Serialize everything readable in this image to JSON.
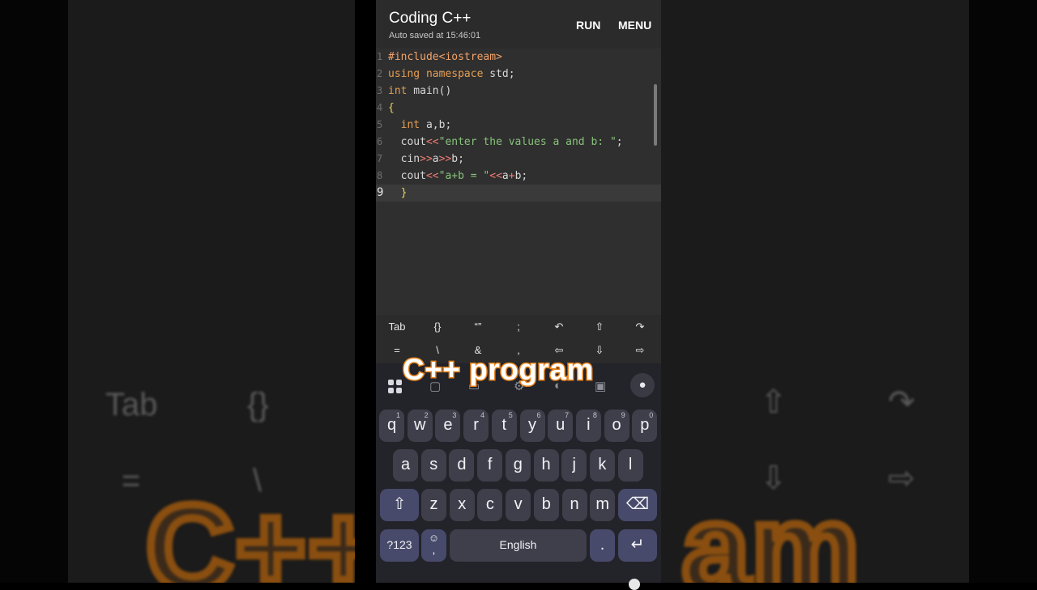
{
  "app": {
    "title": "Coding C++",
    "autosave": "Auto saved at 15:46:01",
    "run_label": "RUN",
    "menu_label": "MENU"
  },
  "editor": {
    "active_line": 9,
    "lines": [
      {
        "n": "1",
        "parts": [
          [
            "pre",
            "#include<iostream>"
          ]
        ]
      },
      {
        "n": "2",
        "parts": [
          [
            "kw",
            "using"
          ],
          [
            "plain",
            " "
          ],
          [
            "kw",
            "namespace"
          ],
          [
            "plain",
            " std;"
          ]
        ]
      },
      {
        "n": "3",
        "parts": [
          [
            "kw",
            "int"
          ],
          [
            "plain",
            " main()"
          ]
        ]
      },
      {
        "n": "4",
        "parts": [
          [
            "brace",
            "{"
          ]
        ]
      },
      {
        "n": "5",
        "parts": [
          [
            "plain",
            "  "
          ],
          [
            "kw",
            "int"
          ],
          [
            "plain",
            " a,b;"
          ]
        ]
      },
      {
        "n": "6",
        "parts": [
          [
            "plain",
            "  cout"
          ],
          [
            "op",
            "<<"
          ],
          [
            "str",
            "\"enter the values a and b: \""
          ],
          [
            "plain",
            ";"
          ]
        ]
      },
      {
        "n": "7",
        "parts": [
          [
            "plain",
            "  cin"
          ],
          [
            "op",
            ">>"
          ],
          [
            "plain",
            "a"
          ],
          [
            "op",
            ">>"
          ],
          [
            "plain",
            "b;"
          ]
        ]
      },
      {
        "n": "8",
        "parts": [
          [
            "plain",
            "  cout"
          ],
          [
            "op",
            "<<"
          ],
          [
            "str",
            "\"a+b = \""
          ],
          [
            "op",
            "<<"
          ],
          [
            "plain",
            "a"
          ],
          [
            "op",
            "+"
          ],
          [
            "plain",
            "b;"
          ]
        ]
      },
      {
        "n": "9",
        "parts": [
          [
            "plain",
            "  "
          ],
          [
            "brace",
            "}"
          ]
        ]
      }
    ]
  },
  "symbols": {
    "row1": [
      "Tab",
      "{}",
      "“”",
      ";",
      "↶",
      "⇧",
      "↷"
    ],
    "row2": [
      "=",
      "\\",
      "&",
      ",",
      "⇦",
      "⇩",
      "⇨"
    ]
  },
  "keyboard": {
    "row1": [
      [
        "q",
        "1"
      ],
      [
        "w",
        "2"
      ],
      [
        "e",
        "3"
      ],
      [
        "r",
        "4"
      ],
      [
        "t",
        "5"
      ],
      [
        "y",
        "6"
      ],
      [
        "u",
        "7"
      ],
      [
        "i",
        "8"
      ],
      [
        "o",
        "9"
      ],
      [
        "p",
        "0"
      ]
    ],
    "row2": [
      "a",
      "s",
      "d",
      "f",
      "g",
      "h",
      "j",
      "k",
      "l"
    ],
    "row3": [
      "z",
      "x",
      "c",
      "v",
      "b",
      "n",
      "m"
    ],
    "shift_icon": "⇧",
    "backspace_icon": "⌫",
    "numbers_label": "?123",
    "emoji_icon": "☺",
    "comma_label": ",",
    "space_label": "English",
    "period_label": ".",
    "enter_icon": "↵",
    "mic_icon": "🎤"
  },
  "caption": "C++ program",
  "background": {
    "tab": "Tab",
    "braces": "{}",
    "equals": "=",
    "backslash": "\\",
    "big_left": "C++",
    "big_right": "am",
    "shift_up": "⇧",
    "redo": "↷",
    "down": "⇩",
    "right": "⇨"
  },
  "colors": {
    "preprocessor": "#f3a368",
    "keyword": "#e59e54",
    "string": "#87c27a",
    "brace": "#e6d35a",
    "operator": "#f07a72",
    "caption_stroke": "#e8831c"
  }
}
